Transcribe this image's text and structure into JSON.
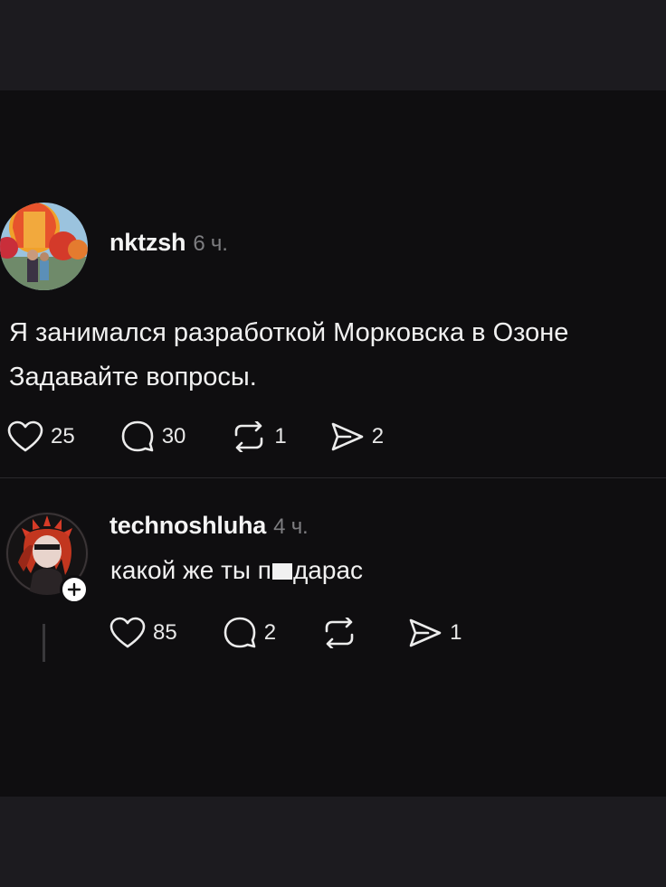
{
  "post": {
    "username": "nktzsh",
    "time": "6 ч.",
    "lines": [
      "Я занимался разработкой Морковска в Озоне",
      "Задавайте вопросы."
    ],
    "likes": "25",
    "comments": "30",
    "reposts": "1",
    "shares": "2"
  },
  "reply": {
    "username": "technoshluha",
    "time": "4 ч.",
    "text_before": "какой же ты п",
    "text_after": "дарас",
    "likes": "85",
    "comments": "2",
    "reposts": "",
    "shares": "1"
  },
  "colors": {
    "background": "#0f0e10",
    "text": "#f1f1f1",
    "muted": "#7d7d80"
  }
}
